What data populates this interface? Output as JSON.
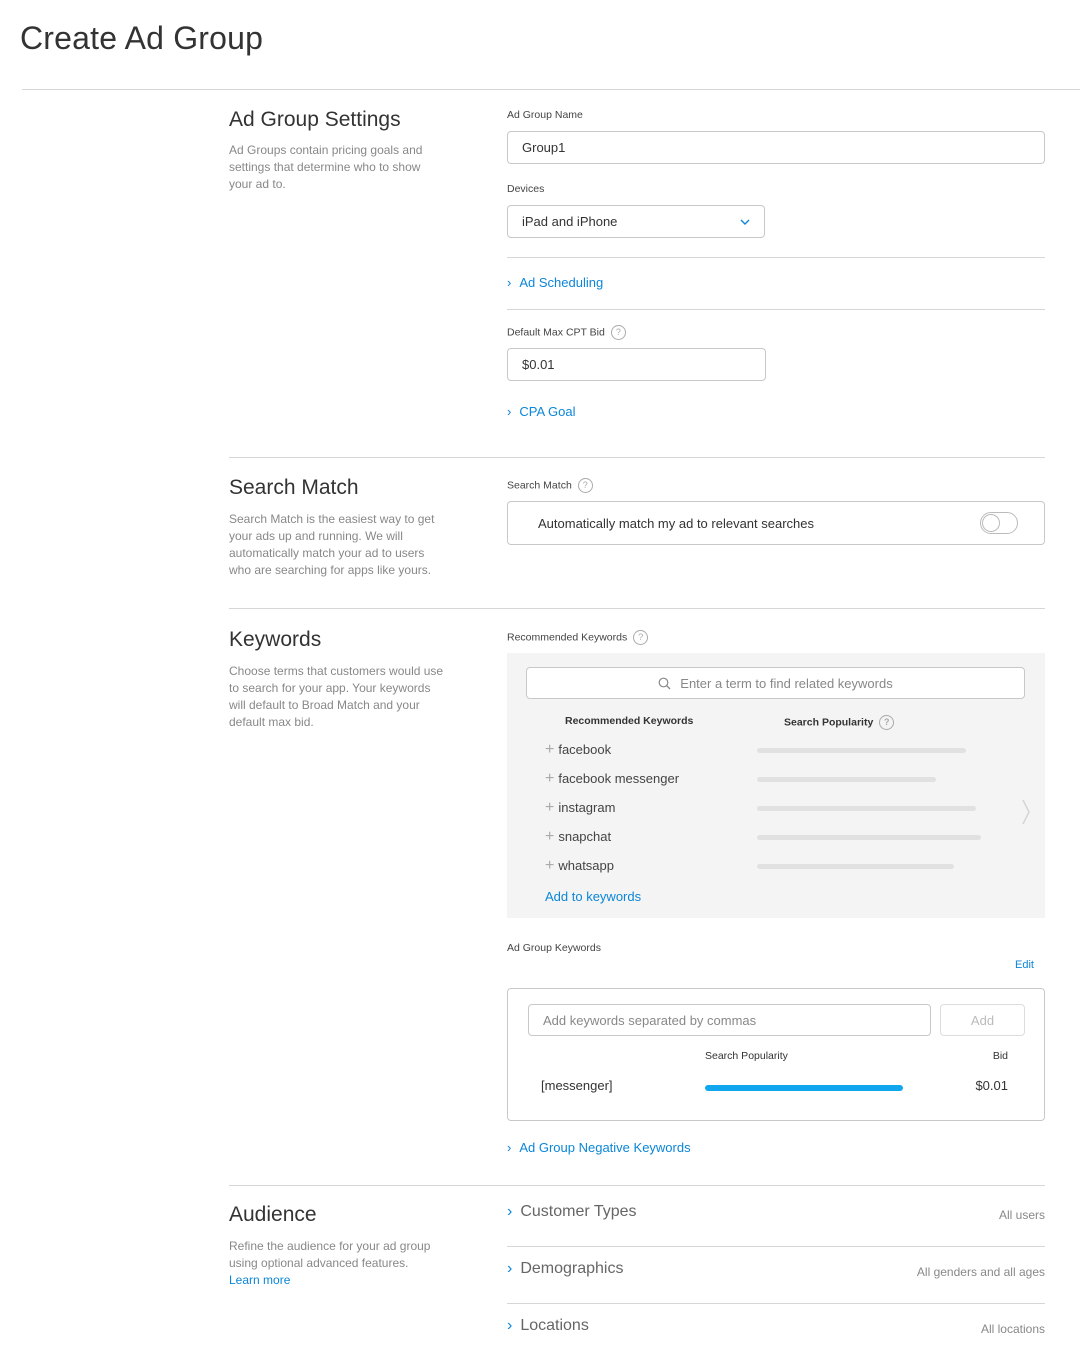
{
  "page": {
    "title": "Create Ad Group"
  },
  "settings": {
    "title": "Ad Group Settings",
    "description": "Ad Groups contain pricing goals and settings that determine who to show your ad to.",
    "name_label": "Ad Group Name",
    "name_value": "Group1",
    "devices_label": "Devices",
    "devices_value": "iPad and iPhone",
    "ad_scheduling": "Ad Scheduling",
    "bid_label": "Default Max CPT Bid",
    "bid_value": "$0.01",
    "cpa_goal": "CPA Goal"
  },
  "search_match": {
    "title": "Search Match",
    "description": "Search Match is the easiest way to get your ads up and running. We will automatically match your ad to users who are searching for apps like yours.",
    "label": "Search Match",
    "toggle_text": "Automatically match my ad to relevant searches",
    "toggle_on": false
  },
  "keywords": {
    "title": "Keywords",
    "description": "Choose terms that customers would use to search for your app. Your keywords will default to Broad Match and your default max bid.",
    "recommended_label": "Recommended Keywords",
    "search_placeholder": "Enter a term to find related keywords",
    "col_keyword": "Recommended Keywords",
    "col_popularity": "Search Popularity",
    "recommended": [
      {
        "text": "facebook",
        "popularity": 0.84
      },
      {
        "text": "facebook messenger",
        "popularity": 0.72
      },
      {
        "text": "instagram",
        "popularity": 0.88
      },
      {
        "text": "snapchat",
        "popularity": 0.9
      },
      {
        "text": "whatsapp",
        "popularity": 0.79
      }
    ],
    "add_to_keywords": "Add to keywords",
    "adgroup_label": "Ad Group Keywords",
    "edit": "Edit",
    "add_placeholder": "Add keywords separated by commas",
    "add_button": "Add",
    "table_popularity": "Search Popularity",
    "table_bid": "Bid",
    "rows": [
      {
        "keyword": "[messenger]",
        "popularity": 1.0,
        "bid": "$0.01"
      }
    ],
    "negative": "Ad Group Negative Keywords",
    "accent": "#11a7ef"
  },
  "audience": {
    "title": "Audience",
    "description": "Refine the audience for your ad group using optional advanced features.",
    "learn_more": "Learn more",
    "rows": [
      {
        "title": "Customer Types",
        "value": "All users"
      },
      {
        "title": "Demographics",
        "value": "All genders and all ages"
      },
      {
        "title": "Locations",
        "value": "All locations"
      }
    ]
  }
}
